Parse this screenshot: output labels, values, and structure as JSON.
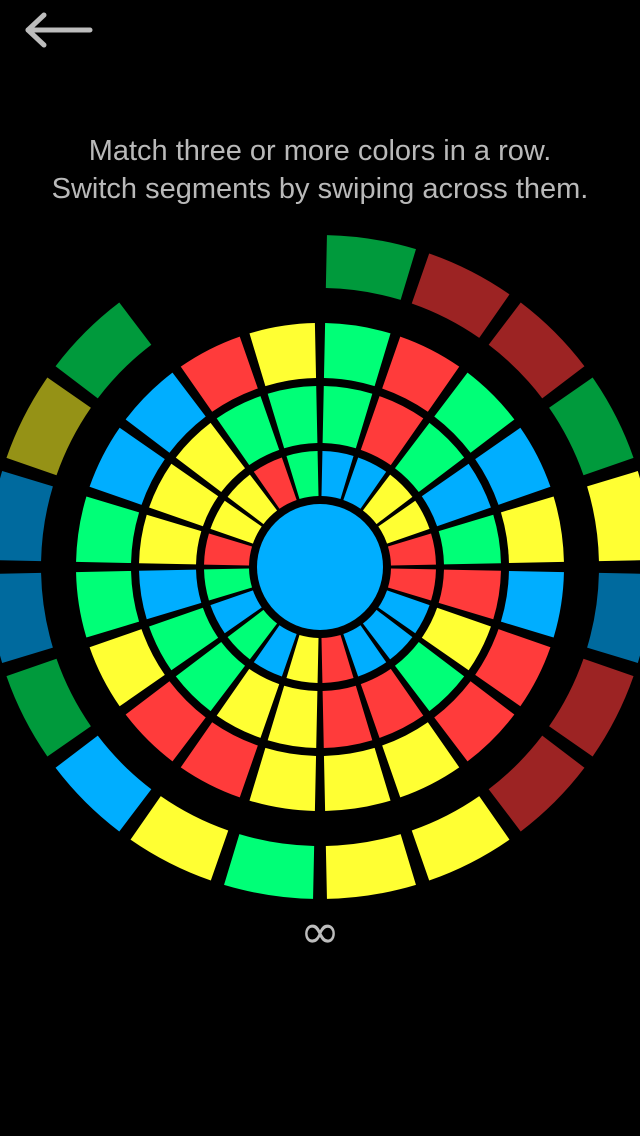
{
  "header": {
    "back_icon": "arrow-left-icon"
  },
  "instructions": {
    "line1": "Match three or more colors in a row.",
    "line2": "Switch segments by swiping across them."
  },
  "colors": {
    "background": "#000000",
    "text": "#b9b9b9",
    "inner": {
      "Y": "#ffff33",
      "G": "#00ff77",
      "R": "#ff3b3b",
      "B": "#00aeff"
    },
    "outer": {
      "B": "#006a9e",
      "R": "#9c2323",
      "O": "#959216",
      "G": "#009a3c",
      "C": "#00aeff",
      "Y": "#ffff33",
      "N": "#00ff77"
    },
    "center": "#00aeff"
  },
  "board": {
    "segments_per_ring": 20,
    "rings": [
      [
        "B",
        "B",
        "Y",
        "Y",
        "R",
        "R",
        "B",
        "B",
        "B",
        "R",
        "Y",
        "B",
        "G",
        "B",
        "G",
        "R",
        "Y",
        "Y",
        "R",
        "G"
      ],
      [
        "G",
        "R",
        "G",
        "B",
        "G",
        "R",
        "Y",
        "G",
        "R",
        "R",
        "Y",
        "Y",
        "G",
        "G",
        "B",
        "Y",
        "Y",
        "Y",
        "G",
        "G"
      ],
      [
        "G",
        "R",
        "G",
        "B",
        "Y",
        "B",
        "R",
        "R",
        "Y",
        "Y",
        "Y",
        "R",
        "R",
        "Y",
        "G",
        "G",
        "B",
        "B",
        "R",
        "Y"
      ],
      [
        "G",
        "R",
        "R",
        "G",
        "Y",
        "B",
        "R",
        "R",
        "Y",
        "Y",
        "N",
        "Y",
        "C",
        "G",
        "B",
        "B",
        "O",
        "G"
      ]
    ],
    "outer_start_segment": 0,
    "center_color": "B",
    "game_state": "in-progress"
  },
  "footer": {
    "moves_symbol": "∞"
  }
}
